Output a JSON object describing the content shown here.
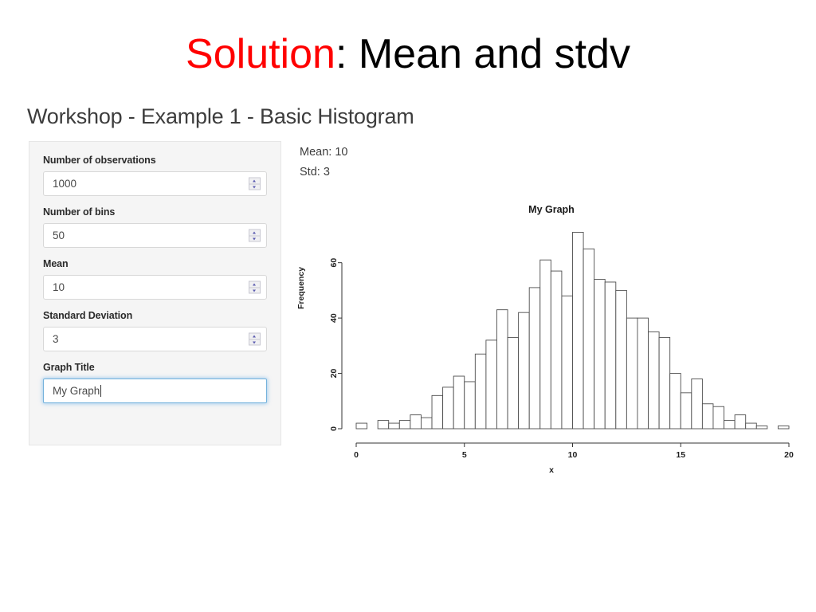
{
  "slide": {
    "title_accent": "Solution",
    "title_rest": ": Mean and stdv"
  },
  "app": {
    "heading": "Workshop - Example 1 - Basic Histogram"
  },
  "form": {
    "fields": [
      {
        "label": "Number of observations",
        "value": "1000",
        "type": "number",
        "focused": false
      },
      {
        "label": "Number of bins",
        "value": "50",
        "type": "number",
        "focused": false
      },
      {
        "label": "Mean",
        "value": "10",
        "type": "number",
        "focused": false
      },
      {
        "label": "Standard Deviation",
        "value": "3",
        "type": "number",
        "focused": false
      },
      {
        "label": "Graph Title",
        "value": "My Graph",
        "type": "text",
        "focused": true
      }
    ]
  },
  "output": {
    "mean_text": "Mean: 10",
    "std_text": "Std: 3"
  },
  "colors": {
    "accent": "#ff0000",
    "panel_bg": "#f5f5f5",
    "focus_ring": "#66afe9",
    "bar_stroke": "#4d4d4d",
    "text": "#3d3d3d"
  },
  "chart_data": {
    "type": "bar",
    "title": "My Graph",
    "xlabel": "x",
    "ylabel": "Frequency",
    "xlim": [
      0,
      20
    ],
    "ylim": [
      0,
      72
    ],
    "xticks": [
      0,
      5,
      10,
      15,
      20
    ],
    "yticks": [
      0,
      20,
      40,
      60
    ],
    "grid": false,
    "legend": null,
    "bin_width": 0.5,
    "bin_starts": [
      0.0,
      1.0,
      1.5,
      2.0,
      2.5,
      3.0,
      3.5,
      4.0,
      4.5,
      5.0,
      5.5,
      6.0,
      6.5,
      7.0,
      7.5,
      8.0,
      8.5,
      9.0,
      9.5,
      10.0,
      10.5,
      11.0,
      11.5,
      12.0,
      12.5,
      13.0,
      13.5,
      14.0,
      14.5,
      15.0,
      15.5,
      16.0,
      16.5,
      17.0,
      17.5,
      18.0,
      18.5,
      19.5
    ],
    "values": [
      2,
      3,
      2,
      3,
      5,
      4,
      12,
      15,
      19,
      17,
      27,
      32,
      43,
      33,
      42,
      51,
      61,
      57,
      48,
      71,
      65,
      54,
      53,
      50,
      40,
      40,
      35,
      33,
      20,
      13,
      18,
      9,
      8,
      3,
      5,
      2,
      1,
      1
    ]
  }
}
